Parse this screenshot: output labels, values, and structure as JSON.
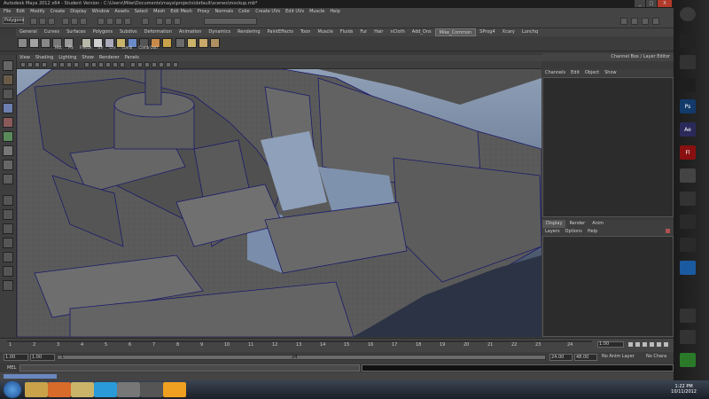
{
  "window": {
    "title": "Autodesk Maya 2012 x64 - Student Version : C:\\Users\\Mike\\Documents\\maya\\projects\\default\\scenes\\mockup.mb*",
    "buttons": [
      "_",
      "□",
      "X"
    ]
  },
  "menubar": [
    "File",
    "Edit",
    "Modify",
    "Create",
    "Display",
    "Window",
    "Assets",
    "Select",
    "Mesh",
    "Edit Mesh",
    "Proxy",
    "Normals",
    "Color",
    "Create UVs",
    "Edit UVs",
    "Muscle",
    "Help"
  ],
  "status_line": {
    "mode": "Polygons"
  },
  "shelf": {
    "tabs": [
      "General",
      "Curves",
      "Surfaces",
      "Polygons",
      "Subdivs",
      "Deformation",
      "Animation",
      "Dynamics",
      "Rendering",
      "PaintEffects",
      "Toon",
      "Muscle",
      "Fluids",
      "Fur",
      "Hair",
      "nCloth",
      "Add_Ons",
      "Mike_Common",
      "SProg4",
      "Xcary",
      "Lunchq"
    ],
    "active_tab": "Mike_Common",
    "icon_labels": [
      "Hist",
      "Piv",
      "Freeze",
      "UV",
      "Crv",
      "Comb",
      "Comb Outl"
    ]
  },
  "panel": {
    "menu": [
      "View",
      "Shading",
      "Lighting",
      "Show",
      "Renderer",
      "Panels"
    ]
  },
  "channel_box": {
    "header": "Channel Box / Layer Editor",
    "menu": [
      "Channels",
      "Edit",
      "Object",
      "Show"
    ]
  },
  "layer_editor": {
    "tabs": [
      "Display",
      "Render",
      "Anim"
    ],
    "active_tab": "Display",
    "menu": [
      "Layers",
      "Options",
      "Help"
    ]
  },
  "time_slider": {
    "ticks": [
      "1",
      "2",
      "3",
      "4",
      "5",
      "6",
      "7",
      "8",
      "9",
      "10",
      "11",
      "12",
      "13",
      "14",
      "15",
      "16",
      "17",
      "18",
      "19",
      "20",
      "21",
      "22",
      "23",
      "24"
    ],
    "current_frame": "1.00"
  },
  "range_slider": {
    "start_time": "1.00",
    "playback_start": "1.00",
    "range_start_label": "1",
    "range_end_label": "24",
    "playback_end": "24.00",
    "end_time": "48.00",
    "anim_layer": "No Anim Layer",
    "char_set": "No Chara"
  },
  "command_line": {
    "label": "MEL"
  },
  "taskbar": {
    "time": "1:22 PM",
    "date": "10/11/2012"
  },
  "dock_icons": [
    "maya-icon",
    "steam-icon",
    "chrome-icon",
    "photoshop-icon",
    "after-effects-icon",
    "flash-icon",
    "unity-icon",
    "monitor-icon",
    "alien-icon",
    "runner-icon",
    "dropbox-icon"
  ],
  "dock_labels": {
    "ps": "Ps",
    "ae": "Ae",
    "fl": "Fl"
  }
}
